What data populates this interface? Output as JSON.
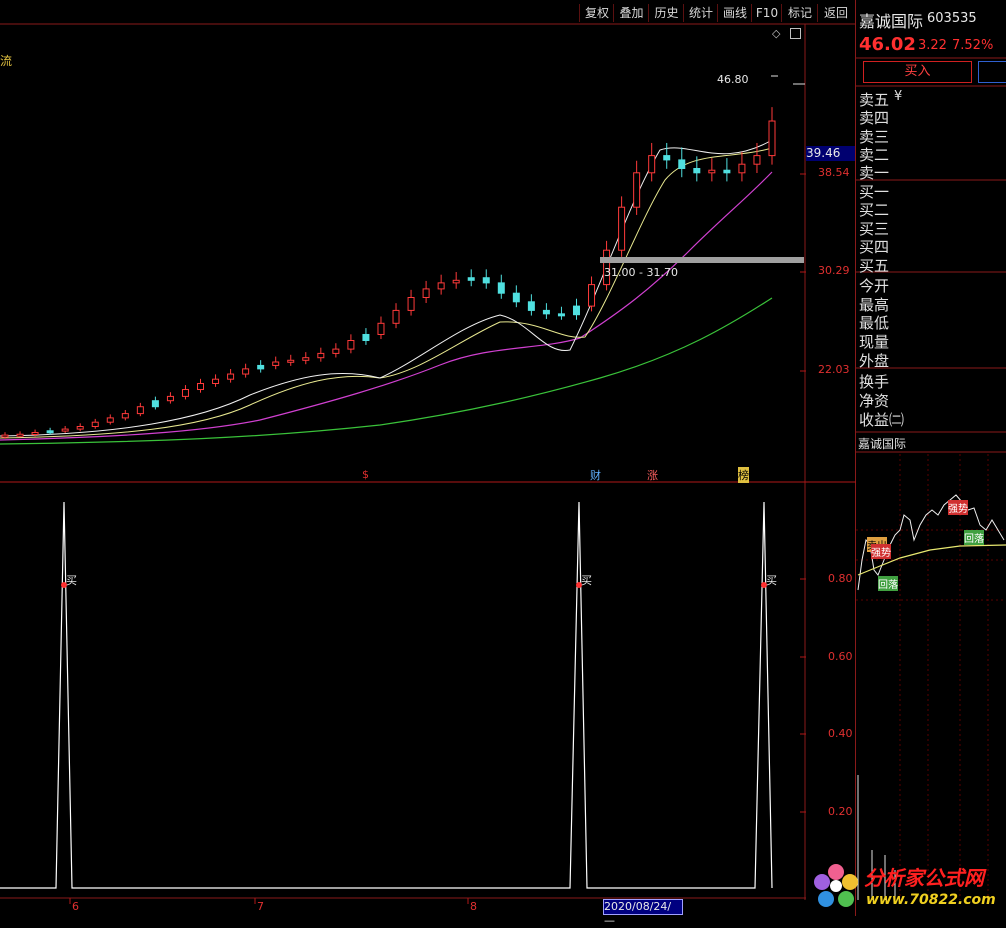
{
  "toolbar": {
    "buttons": [
      "复权",
      "叠加",
      "历史",
      "统计",
      "画线",
      "F10",
      "标记",
      "返回"
    ]
  },
  "indicator_label": "流",
  "stock": {
    "name": "嘉诚国际",
    "code": "603535",
    "price": "46.02",
    "change": "3.22",
    "change_pct": "7.52%",
    "buy_label": "买入"
  },
  "quote_rows": [
    "卖五",
    "卖四",
    "卖三",
    "卖二",
    "卖一",
    "买一",
    "买二",
    "买三",
    "买四",
    "买五",
    "今开",
    "最高",
    "最低",
    "现量",
    "外盘",
    "换手",
    "净资",
    "收益㈡"
  ],
  "yuan_symbol": "¥",
  "mini_chart": {
    "title": "嘉诚国际",
    "labels": [
      "卖出",
      "强势",
      "回落",
      "强势",
      "回落"
    ]
  },
  "main_chart": {
    "y_ticks": [
      "38.54",
      "30.29",
      "22.03"
    ],
    "current_price_tag": "39.46",
    "max_label": "46.80",
    "range_label": "31.00 - 31.70",
    "event_markers": [
      "$",
      "财",
      "涨",
      "榜"
    ]
  },
  "sub_chart": {
    "y_ticks": [
      "0.80",
      "0.60",
      "0.40",
      "0.20"
    ],
    "signal_label": "买"
  },
  "x_axis": {
    "months": [
      "6",
      "7",
      "8"
    ],
    "cursor_date": "2020/08/24/—"
  },
  "watermark": {
    "line1": "分析家公式网",
    "line2": "www.70822.com"
  },
  "chart_data": [
    {
      "type": "candlestick",
      "series": [
        {
          "name": "",
          "values": [
            9.5,
            9.6,
            9.8,
            10,
            10.2,
            10.5,
            11,
            11.5,
            12,
            12.8,
            13.5,
            14,
            14.8,
            15.5,
            16,
            16.6,
            17.2,
            17.6,
            18,
            18.2,
            18.5,
            19,
            19.5,
            20.5,
            21.2,
            22.5,
            24,
            25.5,
            26.5,
            27.2,
            27.5,
            27.8,
            27.2,
            26,
            25,
            24,
            23.6,
            23.5,
            24.5,
            27,
            31,
            36,
            40,
            42,
            41.5,
            40.5,
            40,
            40.3,
            40,
            41,
            42,
            46.02
          ]
        }
      ],
      "y_ticks": [
        38.54,
        30.29,
        22.03
      ],
      "max": 46.8
    },
    {
      "type": "line",
      "y_ticks": [
        0.8,
        0.6,
        0.4,
        0.2
      ],
      "signals": [
        1,
        1,
        1
      ]
    }
  ]
}
